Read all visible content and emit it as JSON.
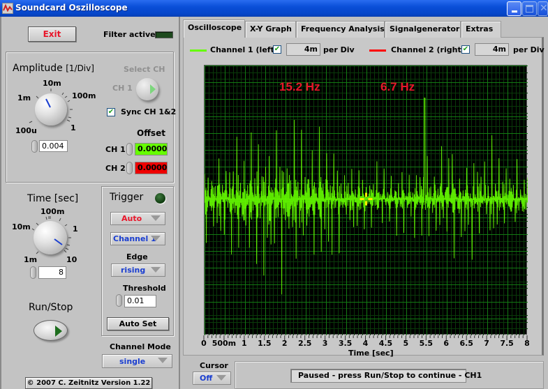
{
  "window": {
    "title": "Soundcard Oszilloscope",
    "controls": [
      "minimize",
      "maximize",
      "close"
    ]
  },
  "left_panel": {
    "exit_label": "Exit",
    "filter_label": "Filter active",
    "amplitude": {
      "title": "Amplitude",
      "unit": "[1/Div]",
      "knob_labels": [
        "100u",
        "1m",
        "10m",
        "100m",
        "1"
      ],
      "value": "0.004",
      "select_ch_label": "Select CH",
      "select_ch_value": "CH 1",
      "sync_label": "Sync CH 1&2",
      "sync_checked": true,
      "offset_label": "Offset",
      "ch1_label": "CH 1",
      "ch1_offset": "0.0000",
      "ch2_label": "CH 2",
      "ch2_offset": "0.0000",
      "ch1_color": "#66ff00",
      "ch2_color": "#ee0000"
    },
    "time": {
      "title": "Time [sec]",
      "knob_labels": [
        "1m",
        "10m",
        "100m",
        "1",
        "10"
      ],
      "value": "8"
    },
    "trigger": {
      "title": "Trigger",
      "mode": "Auto",
      "channel": "Channel 1",
      "edge_label": "Edge",
      "edge": "rising",
      "threshold_label": "Threshold",
      "threshold": "0.01",
      "autoset_label": "Auto Set"
    },
    "run_stop_label": "Run/Stop",
    "channel_mode_label": "Channel Mode",
    "channel_mode": "single",
    "copyright": "© 2007  C. Zeitnitz Version 1.22"
  },
  "tabs": [
    {
      "label": "Oscilloscope",
      "active": true
    },
    {
      "label": "X-Y Graph",
      "active": false
    },
    {
      "label": "Frequency Analysis",
      "active": false
    },
    {
      "label": "Signalgenerator",
      "active": false
    },
    {
      "label": "Extras",
      "active": false
    }
  ],
  "channels": {
    "ch1_label": "Channel 1 (left)",
    "ch1_checked": true,
    "ch1_div": "4m",
    "ch2_label": "Channel 2 (right)",
    "ch2_checked": true,
    "ch2_div": "4m",
    "per_div": "per Div",
    "ch1_color": "#66ff00",
    "ch2_color": "#ff0000"
  },
  "cursor": {
    "label": "Cursor",
    "value": "Off"
  },
  "status": "Paused - press Run/Stop to continue - CH1",
  "chart_data": {
    "type": "line",
    "title": "",
    "xlabel": "Time [sec]",
    "ylabel": "",
    "xlim": [
      0,
      8
    ],
    "x_ticks": [
      "0",
      "500m",
      "1",
      "1.5",
      "2",
      "2.5",
      "3",
      "3.5",
      "4",
      "4.5",
      "5",
      "5.5",
      "6",
      "6.5",
      "7",
      "7.5",
      "8"
    ],
    "grid": true,
    "annotations": [
      {
        "text": "15.2 Hz",
        "color": "#e8162a"
      },
      {
        "text": "6.7 Hz",
        "color": "#e8162a"
      }
    ],
    "series": [
      {
        "name": "Channel 1 (left)",
        "color": "#66ff00",
        "description": "noisy audio signal, spiky oscillation centered around zero, peak deflection about ±2.5 divisions"
      }
    ],
    "y_divisions": 8,
    "x_divisions": 16,
    "cursor_marker_x": 4.0
  }
}
